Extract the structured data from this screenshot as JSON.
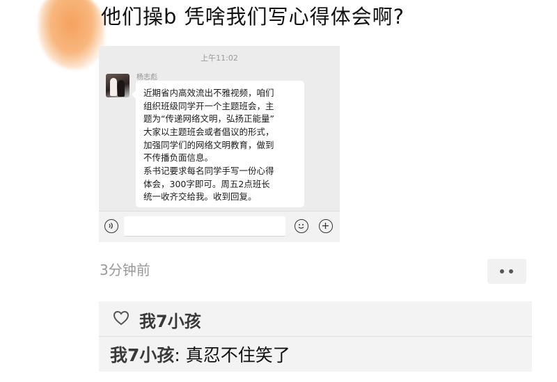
{
  "post": {
    "text": "他们操b  凭啥我们写心得体会啊?"
  },
  "chat": {
    "time": "上午11:02",
    "sender": "杨志彪",
    "message_lines": [
      "近期省内高效流出不雅视频，咱们",
      "组织班级同学开一个主题班会，主",
      "题为“传递网络文明，弘扬正能量”",
      "大家以主题班会或者倡议的形式，",
      "加强同学们的网络文明教育，做到",
      "不传播负面信息。",
      "系书记要求每名同学手写一份心得",
      "体会，300字即可。周五2点班长",
      "统一收齐交给我。收到回复。"
    ],
    "icons": [
      "voice-icon",
      "emoji-icon",
      "plus-icon"
    ]
  },
  "meta": {
    "time_ago": "3分钟前"
  },
  "likes": {
    "icon": "heart-icon",
    "names": "我7小孩"
  },
  "comments": [
    {
      "author": "我7小孩",
      "separator": ": ",
      "text": "真忍不住笑了"
    }
  ],
  "colors": {
    "feed_bg": "#ffffff",
    "chat_bg": "#ececec",
    "comment_bg": "#f3f3f3",
    "name_color": "#3a3a3a",
    "muted": "#999999"
  }
}
